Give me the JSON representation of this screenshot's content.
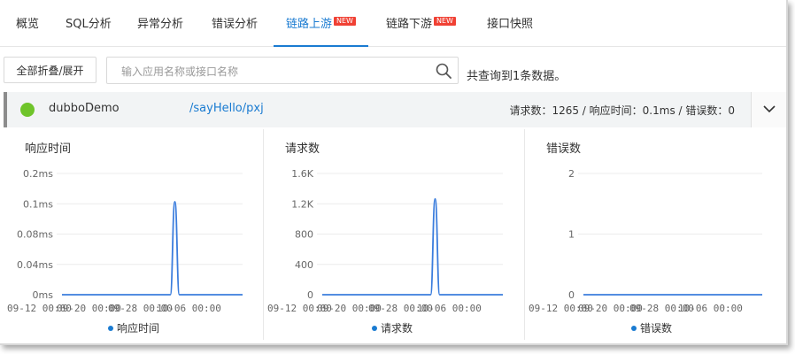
{
  "tabs": [
    {
      "label": "概览",
      "active": false,
      "badge": ""
    },
    {
      "label": "SQL分析",
      "active": false,
      "badge": ""
    },
    {
      "label": "异常分析",
      "active": false,
      "badge": ""
    },
    {
      "label": "错误分析",
      "active": false,
      "badge": ""
    },
    {
      "label": "链路上游",
      "active": true,
      "badge": "NEW"
    },
    {
      "label": "链路下游",
      "active": false,
      "badge": "NEW"
    },
    {
      "label": "接口快照",
      "active": false,
      "badge": ""
    }
  ],
  "toolbar": {
    "collapse_label": "全部折叠/展开",
    "search_placeholder": "输入应用名称或接口名称",
    "search_value": "",
    "search_icon": "search-icon",
    "result_text": "共查询到1条数据。"
  },
  "service": {
    "status_color": "#6fc42a",
    "name": "dubboDemo",
    "path": "/sayHello/pxj",
    "stats": "请求数：1265 / 响应时间：0.1ms / 错误数：0",
    "expand_icon": "chevron-down-icon"
  },
  "colors": {
    "accent": "#1a7bd1",
    "badge": "#f04134",
    "series": "#3b7ddd",
    "status_ok": "#6fc42a"
  },
  "chart_data": [
    {
      "type": "line",
      "title": "响应时间",
      "x": [
        "09-12 00:00",
        "09-20 00:00",
        "09-28 00:00",
        "10-06 00:00"
      ],
      "series": [
        {
          "name": "响应时间",
          "points": [
            [
              0,
              0
            ],
            [
              0.6,
              0
            ],
            [
              0.625,
              0.107
            ],
            [
              0.65,
              0
            ],
            [
              1,
              0
            ]
          ]
        }
      ],
      "ytick_values": [
        0,
        0.04,
        0.08,
        0.1,
        0.2
      ],
      "ytick_labels": [
        "0ms",
        "0.04ms",
        "0.08ms",
        "0.1ms",
        "0.2ms"
      ],
      "grid": true,
      "legend": "bottom"
    },
    {
      "type": "line",
      "title": "请求数",
      "x": [
        "09-12 00:00",
        "09-20 00:00",
        "09-28 00:00",
        "10-06 00:00"
      ],
      "series": [
        {
          "name": "请求数",
          "points": [
            [
              0,
              0
            ],
            [
              0.6,
              0
            ],
            [
              0.625,
              1265
            ],
            [
              0.65,
              0
            ],
            [
              1,
              0
            ]
          ]
        }
      ],
      "ytick_values": [
        0,
        400,
        800,
        1200,
        1600
      ],
      "ytick_labels": [
        "0",
        "400",
        "800",
        "1.2K",
        "1.6K"
      ],
      "grid": true,
      "legend": "bottom"
    },
    {
      "type": "line",
      "title": "错误数",
      "x": [
        "09-12 00:00",
        "09-20 00:00",
        "09-28 00:00",
        "10-06 00:00"
      ],
      "series": [
        {
          "name": "错误数",
          "points": [
            [
              0,
              0
            ],
            [
              1,
              0
            ]
          ]
        }
      ],
      "ytick_values": [
        0,
        1,
        2
      ],
      "ytick_labels": [
        "0",
        "1",
        "2"
      ],
      "grid": true,
      "legend": "bottom"
    }
  ]
}
